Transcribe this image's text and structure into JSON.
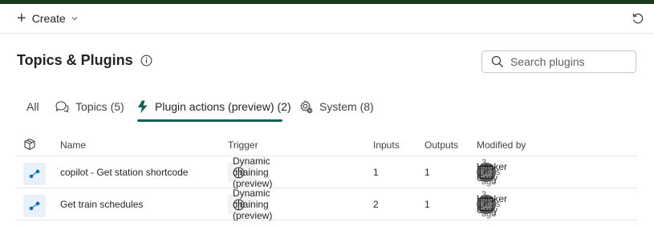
{
  "command_bar": {
    "create_label": "Create"
  },
  "page": {
    "title": "Topics & Plugins"
  },
  "search": {
    "placeholder": "Search plugins"
  },
  "tabs": [
    {
      "label": "All",
      "active": false
    },
    {
      "label": "Topics (5)",
      "active": false
    },
    {
      "label": "Plugin actions (preview) (2)",
      "active": true
    },
    {
      "label": "System (8)",
      "active": false
    }
  ],
  "table": {
    "headers": {
      "name": "Name",
      "trigger": "Trigger",
      "inputs": "Inputs",
      "outputs": "Outputs",
      "modified_by": "Modified by"
    },
    "rows": [
      {
        "name": "copilot - Get station shortcode",
        "trigger": "Dynamic chaining (preview)",
        "inputs": "1",
        "outputs": "1",
        "modified_by": "Hacker Grey",
        "modified_time": "3 days ago",
        "avatar_text": "FF"
      },
      {
        "name": "Get train schedules",
        "trigger": "Dynamic chaining (preview)",
        "inputs": "2",
        "outputs": "1",
        "modified_by": "Hacker Grey",
        "modified_time": "3 days ago",
        "avatar_text": "FF"
      }
    ]
  },
  "colors": {
    "top_strip": "#1b3a1f",
    "active_tab_accent": "#115e59",
    "plugin_icon": "#0f6cbd"
  }
}
